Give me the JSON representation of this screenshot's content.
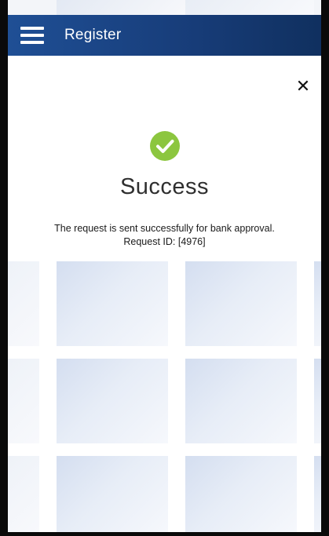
{
  "app_bar": {
    "title": "Register",
    "menu_icon": "hamburger-menu-icon"
  },
  "dialog": {
    "close_icon": "close-icon",
    "status_icon": "check-circle-icon",
    "status_color": "#8cc63f",
    "title": "Success",
    "message_line1": "The request is sent successfully for bank approval.",
    "message_line2": "Request ID: [4976]"
  },
  "colors": {
    "app_bar": "#1f4f95",
    "dialog_bg": "#ffffff"
  }
}
